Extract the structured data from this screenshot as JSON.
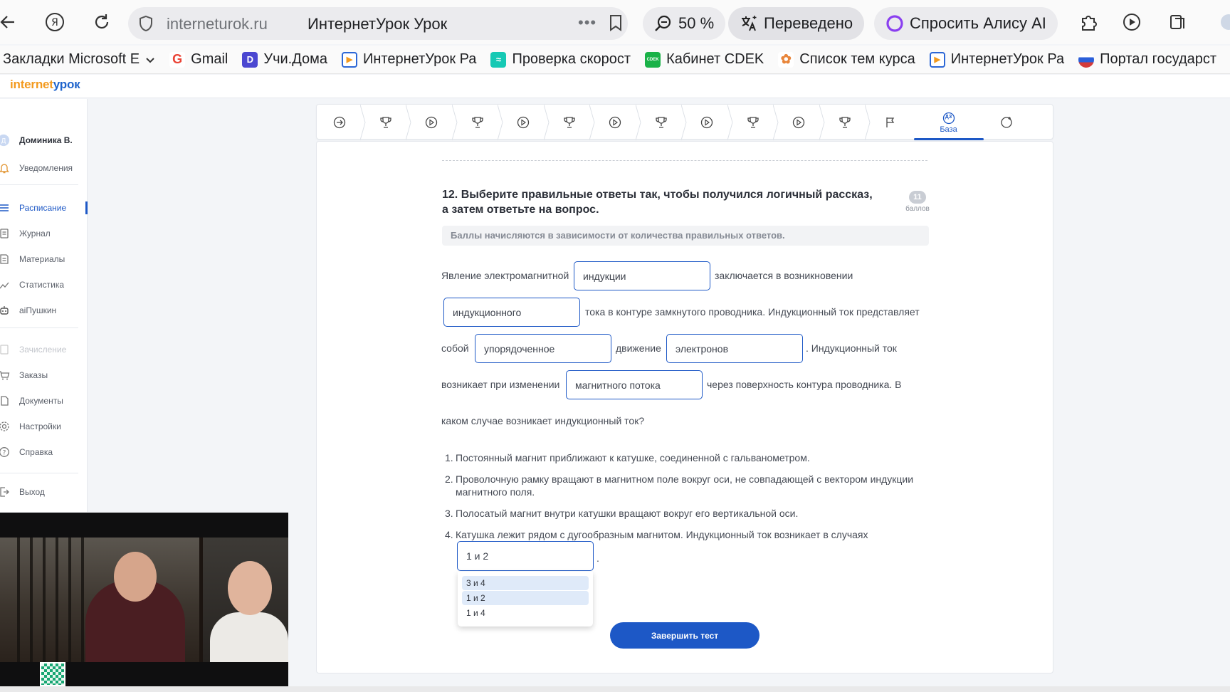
{
  "browser": {
    "url": "interneturok.ru",
    "page_title": "ИнтернетУрок Урок",
    "more_label": "•••",
    "zoom": "50 %",
    "translated_label": "Переведено",
    "alice_label": "Спросить Алису AI"
  },
  "bookmarks": [
    {
      "label": "Закладки Microsoft E",
      "icon": "",
      "color": ""
    },
    {
      "label": "Gmail",
      "icon": "G",
      "color": "#ea4335"
    },
    {
      "label": "Учи.Дома",
      "icon": "D",
      "color": "#4b47d1"
    },
    {
      "label": "ИнтернетУрок Ра",
      "icon": "▶",
      "color": "#2c67d6"
    },
    {
      "label": "Проверка скорост",
      "icon": "≈",
      "color": "#16c9b4"
    },
    {
      "label": "Кабинет CDEK",
      "icon": "CDEK",
      "color": "#1ab248"
    },
    {
      "label": "Список тем курса",
      "icon": "✿",
      "color": "#e8853a"
    },
    {
      "label": "ИнтернетУрок Ра",
      "icon": "▶",
      "color": "#2c67d6"
    },
    {
      "label": "Портал государст",
      "icon": "●",
      "color": "#d33a3a"
    }
  ],
  "site": {
    "logo_part1": "internet",
    "logo_part2": "урок"
  },
  "sidebar": {
    "user": "Доминика В.",
    "items": [
      {
        "label": "Уведомления",
        "icon": "bell-icon"
      },
      {
        "label": "Расписание",
        "icon": "list-icon"
      },
      {
        "label": "Журнал",
        "icon": "journal-icon"
      },
      {
        "label": "Материалы",
        "icon": "materials-icon"
      },
      {
        "label": "Статистика",
        "icon": "chart-icon"
      },
      {
        "label": "aiПушкин",
        "icon": "robot-icon"
      },
      {
        "label": "Зачисление",
        "icon": "document-icon"
      },
      {
        "label": "Заказы",
        "icon": "cart-icon"
      },
      {
        "label": "Документы",
        "icon": "docs-icon"
      },
      {
        "label": "Настройки",
        "icon": "gear-icon"
      },
      {
        "label": "Справка",
        "icon": "help-icon"
      },
      {
        "label": "Выход",
        "icon": "logout-icon"
      }
    ]
  },
  "stepnav": {
    "base_badge": "ДЗ",
    "base_label": "База"
  },
  "question": {
    "title": "12. Выберите правильные ответы так, чтобы получился логичный рассказ, а затем ответьте на вопрос.",
    "points_value": "11",
    "points_label": "баллов",
    "note": "Баллы начисляются в зависимости от количества правильных ответов.",
    "text": {
      "t1": "Явление электромагнитной",
      "t2": "заключается в возникновении",
      "t3": "тока в контуре замкнутого проводника. Индукционный ток представляет",
      "t4": "собой",
      "t5": "движение",
      "t6": ". Индукционный ток",
      "t7": "возникает при изменении",
      "t8": "через поверхность контура проводника. В",
      "t9": "каком случае возникает индукционный ток?"
    },
    "blanks": {
      "b1": "индукции",
      "b2": "индукционного",
      "b3": "упорядоченное",
      "b4": "электронов",
      "b5": "магнитного потока"
    },
    "options": [
      {
        "num": "1.",
        "text": "Постоянный магнит приближают к катушке, соединенной с гальванометром."
      },
      {
        "num": "2.",
        "text": "Проволочную рамку вращают в магнитном поле вокруг оси, не совпадающей с вектором индукции магнитного поля."
      },
      {
        "num": "3.",
        "text": "Полосатый магнит внутри катушки вращают вокруг его вертикальной оси."
      },
      {
        "num": "4.",
        "text": "Катушка лежит рядом с дугообразным магнитом. Индукционный ток возникает в случаях"
      }
    ],
    "answer_select": "1 и 2",
    "answer_suffix": ".",
    "dropdown_options": [
      "3 и 4",
      "1 и 2",
      "1 и 4"
    ],
    "finish_button": "Завершить тест"
  },
  "colors": {
    "accent": "#1d58c6",
    "logo_orange": "#f39a1e"
  }
}
